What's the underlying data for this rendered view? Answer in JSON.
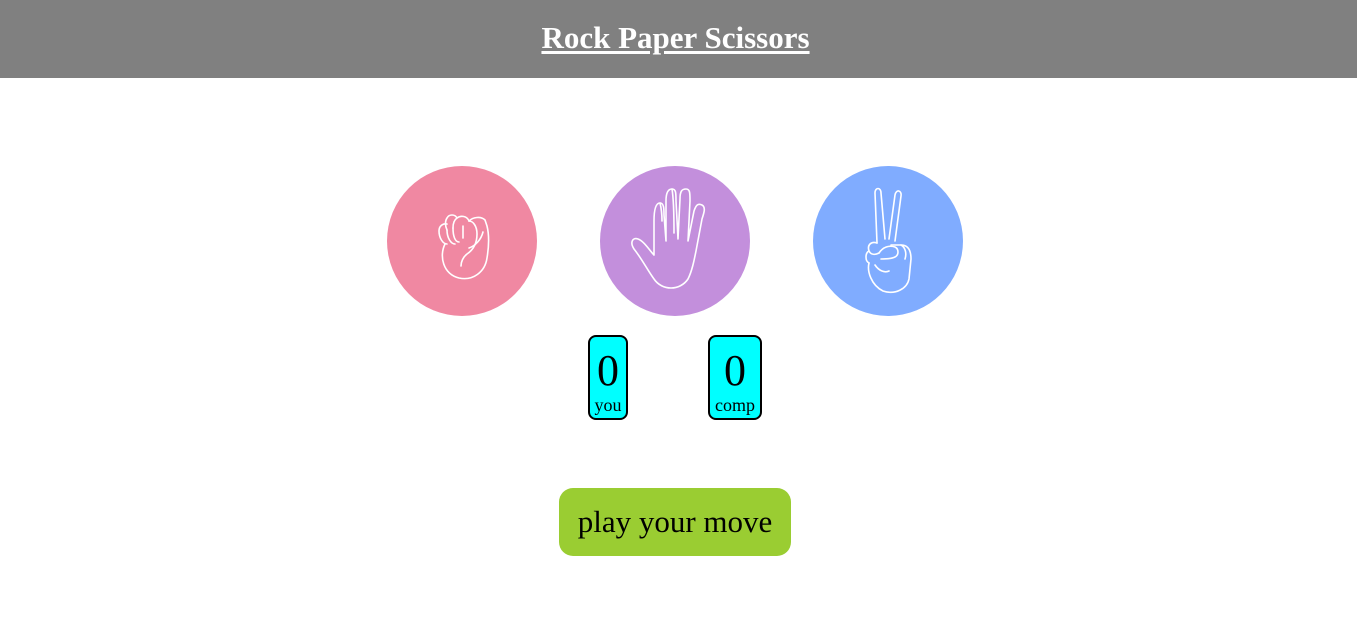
{
  "header": {
    "title": "Rock Paper Scissors"
  },
  "choices": [
    {
      "id": "rock",
      "icon": "fist-icon",
      "color": "#f088a2"
    },
    {
      "id": "paper",
      "icon": "open-hand-icon",
      "color": "#c38fdc"
    },
    {
      "id": "scissors",
      "icon": "peace-sign-hand-icon",
      "color": "#80acff"
    }
  ],
  "scoreboard": {
    "user": {
      "score": "0",
      "label": "you"
    },
    "comp": {
      "score": "0",
      "label": "comp"
    },
    "box_color": "#00ffff"
  },
  "play_button": {
    "label": "play your move",
    "color": "#9acd32"
  },
  "colors": {
    "header_bg": "#808080",
    "header_text": "#ffffff"
  }
}
